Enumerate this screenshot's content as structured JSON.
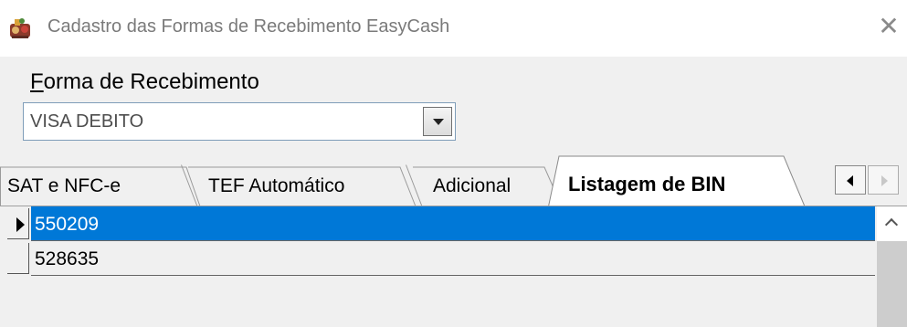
{
  "window": {
    "title": "Cadastro das Formas de Recebimento EasyCash",
    "icon": "app-logo-icon",
    "close_glyph": "✕"
  },
  "form": {
    "label_first": "F",
    "label_rest": "orma de Recebimento",
    "combo_value": "VISA DEBITO"
  },
  "tabs": [
    {
      "label": "SAT e NFC-e",
      "active": false
    },
    {
      "label": "TEF Automático",
      "active": false
    },
    {
      "label": "Adicional",
      "active": false
    },
    {
      "label": "Listagem de BIN",
      "active": true
    }
  ],
  "grid": {
    "rows": [
      {
        "value": "550209",
        "selected": true
      },
      {
        "value": "528635",
        "selected": false
      }
    ]
  },
  "colors": {
    "selection": "#0078d7",
    "client_bg": "#f0f0f0",
    "title_text": "#7a7a7a"
  }
}
